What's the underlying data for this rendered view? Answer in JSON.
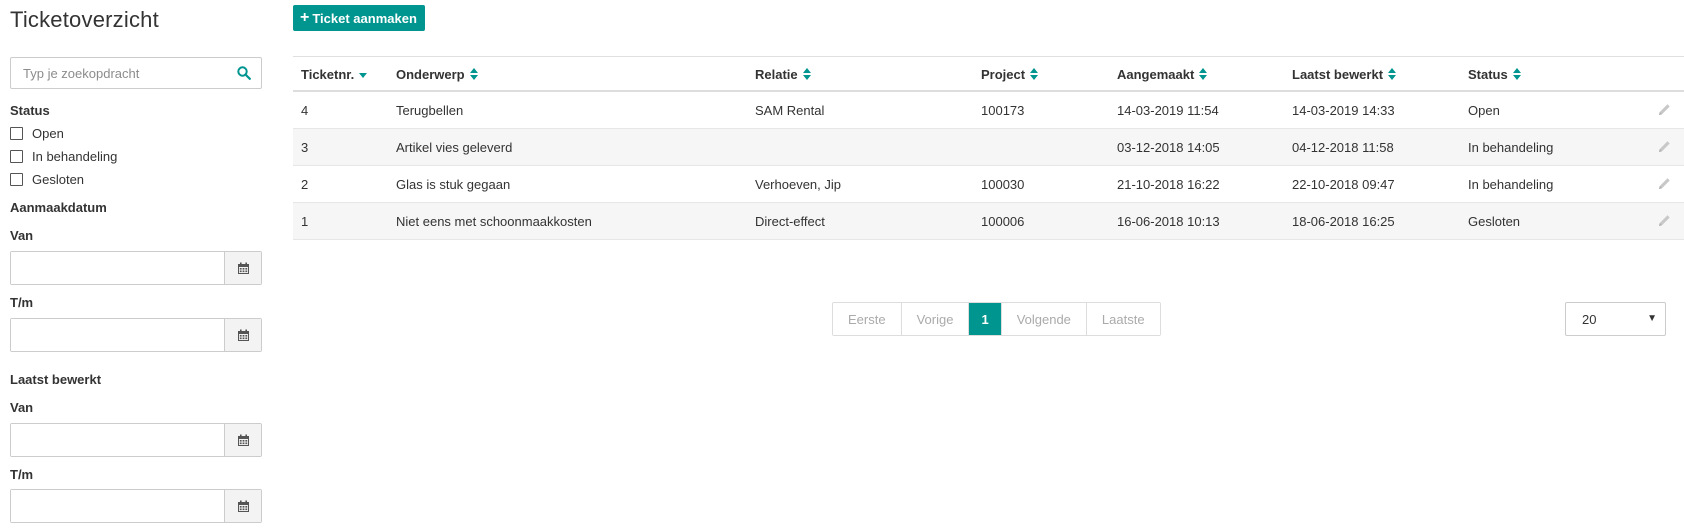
{
  "page": {
    "title": "Ticketoverzicht"
  },
  "sidebar": {
    "search_placeholder": "Typ je zoekopdracht",
    "status_label": "Status",
    "status_options": [
      "Open",
      "In behandeling",
      "Gesloten"
    ],
    "created_label": "Aanmaakdatum",
    "created_from_label": "Van",
    "created_to_label": "T/m",
    "edited_label": "Laatst bewerkt",
    "edited_from_label": "Van",
    "edited_to_label": "T/m"
  },
  "toolbar": {
    "add_label": "Ticket aanmaken"
  },
  "table": {
    "columns": [
      "Ticketnr.",
      "Onderwerp",
      "Relatie",
      "Project",
      "Aangemaakt",
      "Laatst bewerkt",
      "Status"
    ],
    "rows": [
      {
        "nr": "4",
        "subject": "Terugbellen",
        "relation": "SAM Rental",
        "project": "100173",
        "created": "14-03-2019 11:54",
        "edited": "14-03-2019 14:33",
        "status": "Open"
      },
      {
        "nr": "3",
        "subject": "Artikel vies geleverd",
        "relation": "",
        "project": "",
        "created": "03-12-2018 14:05",
        "edited": "04-12-2018 11:58",
        "status": "In behandeling"
      },
      {
        "nr": "2",
        "subject": "Glas is stuk gegaan",
        "relation": "Verhoeven, Jip",
        "project": "100030",
        "created": "21-10-2018 16:22",
        "edited": "22-10-2018 09:47",
        "status": "In behandeling"
      },
      {
        "nr": "1",
        "subject": "Niet eens met schoonmaakkosten",
        "relation": "Direct-effect",
        "project": "100006",
        "created": "16-06-2018 10:13",
        "edited": "18-06-2018 16:25",
        "status": "Gesloten"
      }
    ]
  },
  "pagination": {
    "first": "Eerste",
    "prev": "Vorige",
    "current": "1",
    "next": "Volgende",
    "last": "Laatste",
    "page_size": "20"
  },
  "colors": {
    "accent": "#00958f",
    "row_alt": "#f6f6f6",
    "border": "#dddddd"
  },
  "icons": {
    "search": "search-icon",
    "calendar": "calendar-icon",
    "edit": "pencil-icon",
    "plus": "plus-icon"
  }
}
